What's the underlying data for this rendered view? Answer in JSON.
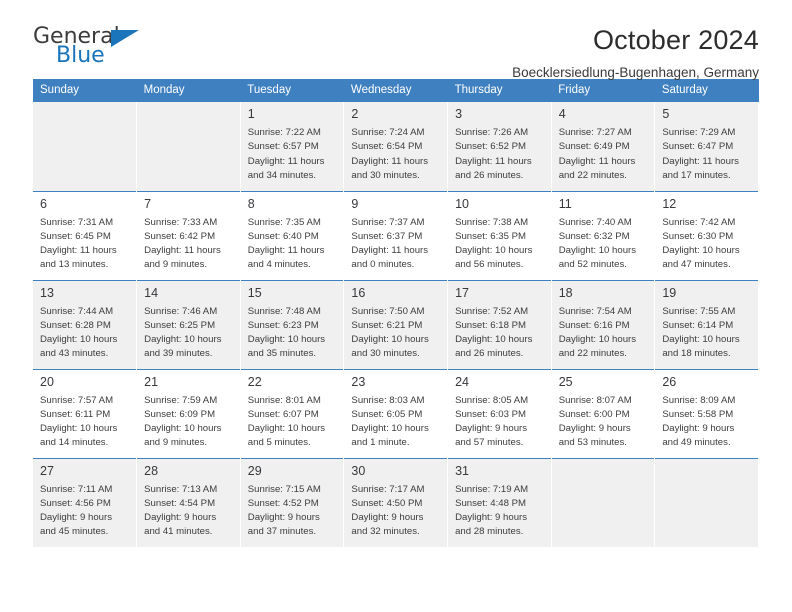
{
  "brand": {
    "name_part1": "General",
    "name_part2": "Blue",
    "triangle_icon": "triangle-icon",
    "accent_color": "#1b75bb"
  },
  "header": {
    "title": "October 2024",
    "subtitle": "Boecklersiedlung-Bugenhagen, Germany"
  },
  "theme": {
    "header_bg": "#3f80c0",
    "header_text": "#ffffff",
    "row_shade": "#f0f0f0",
    "grid_line": "#3f80c0"
  },
  "calendar": {
    "weekday_headers": [
      "Sunday",
      "Monday",
      "Tuesday",
      "Wednesday",
      "Thursday",
      "Friday",
      "Saturday"
    ],
    "labels": {
      "sunrise": "Sunrise:",
      "sunset": "Sunset:",
      "daylight": "Daylight:"
    },
    "weeks": [
      [
        {
          "day": "",
          "sunrise": "",
          "sunset": "",
          "daylight_line1": "",
          "daylight_line2": ""
        },
        {
          "day": "",
          "sunrise": "",
          "sunset": "",
          "daylight_line1": "",
          "daylight_line2": ""
        },
        {
          "day": "1",
          "sunrise": "Sunrise: 7:22 AM",
          "sunset": "Sunset: 6:57 PM",
          "daylight_line1": "Daylight: 11 hours",
          "daylight_line2": "and 34 minutes."
        },
        {
          "day": "2",
          "sunrise": "Sunrise: 7:24 AM",
          "sunset": "Sunset: 6:54 PM",
          "daylight_line1": "Daylight: 11 hours",
          "daylight_line2": "and 30 minutes."
        },
        {
          "day": "3",
          "sunrise": "Sunrise: 7:26 AM",
          "sunset": "Sunset: 6:52 PM",
          "daylight_line1": "Daylight: 11 hours",
          "daylight_line2": "and 26 minutes."
        },
        {
          "day": "4",
          "sunrise": "Sunrise: 7:27 AM",
          "sunset": "Sunset: 6:49 PM",
          "daylight_line1": "Daylight: 11 hours",
          "daylight_line2": "and 22 minutes."
        },
        {
          "day": "5",
          "sunrise": "Sunrise: 7:29 AM",
          "sunset": "Sunset: 6:47 PM",
          "daylight_line1": "Daylight: 11 hours",
          "daylight_line2": "and 17 minutes."
        }
      ],
      [
        {
          "day": "6",
          "sunrise": "Sunrise: 7:31 AM",
          "sunset": "Sunset: 6:45 PM",
          "daylight_line1": "Daylight: 11 hours",
          "daylight_line2": "and 13 minutes."
        },
        {
          "day": "7",
          "sunrise": "Sunrise: 7:33 AM",
          "sunset": "Sunset: 6:42 PM",
          "daylight_line1": "Daylight: 11 hours",
          "daylight_line2": "and 9 minutes."
        },
        {
          "day": "8",
          "sunrise": "Sunrise: 7:35 AM",
          "sunset": "Sunset: 6:40 PM",
          "daylight_line1": "Daylight: 11 hours",
          "daylight_line2": "and 4 minutes."
        },
        {
          "day": "9",
          "sunrise": "Sunrise: 7:37 AM",
          "sunset": "Sunset: 6:37 PM",
          "daylight_line1": "Daylight: 11 hours",
          "daylight_line2": "and 0 minutes."
        },
        {
          "day": "10",
          "sunrise": "Sunrise: 7:38 AM",
          "sunset": "Sunset: 6:35 PM",
          "daylight_line1": "Daylight: 10 hours",
          "daylight_line2": "and 56 minutes."
        },
        {
          "day": "11",
          "sunrise": "Sunrise: 7:40 AM",
          "sunset": "Sunset: 6:32 PM",
          "daylight_line1": "Daylight: 10 hours",
          "daylight_line2": "and 52 minutes."
        },
        {
          "day": "12",
          "sunrise": "Sunrise: 7:42 AM",
          "sunset": "Sunset: 6:30 PM",
          "daylight_line1": "Daylight: 10 hours",
          "daylight_line2": "and 47 minutes."
        }
      ],
      [
        {
          "day": "13",
          "sunrise": "Sunrise: 7:44 AM",
          "sunset": "Sunset: 6:28 PM",
          "daylight_line1": "Daylight: 10 hours",
          "daylight_line2": "and 43 minutes."
        },
        {
          "day": "14",
          "sunrise": "Sunrise: 7:46 AM",
          "sunset": "Sunset: 6:25 PM",
          "daylight_line1": "Daylight: 10 hours",
          "daylight_line2": "and 39 minutes."
        },
        {
          "day": "15",
          "sunrise": "Sunrise: 7:48 AM",
          "sunset": "Sunset: 6:23 PM",
          "daylight_line1": "Daylight: 10 hours",
          "daylight_line2": "and 35 minutes."
        },
        {
          "day": "16",
          "sunrise": "Sunrise: 7:50 AM",
          "sunset": "Sunset: 6:21 PM",
          "daylight_line1": "Daylight: 10 hours",
          "daylight_line2": "and 30 minutes."
        },
        {
          "day": "17",
          "sunrise": "Sunrise: 7:52 AM",
          "sunset": "Sunset: 6:18 PM",
          "daylight_line1": "Daylight: 10 hours",
          "daylight_line2": "and 26 minutes."
        },
        {
          "day": "18",
          "sunrise": "Sunrise: 7:54 AM",
          "sunset": "Sunset: 6:16 PM",
          "daylight_line1": "Daylight: 10 hours",
          "daylight_line2": "and 22 minutes."
        },
        {
          "day": "19",
          "sunrise": "Sunrise: 7:55 AM",
          "sunset": "Sunset: 6:14 PM",
          "daylight_line1": "Daylight: 10 hours",
          "daylight_line2": "and 18 minutes."
        }
      ],
      [
        {
          "day": "20",
          "sunrise": "Sunrise: 7:57 AM",
          "sunset": "Sunset: 6:11 PM",
          "daylight_line1": "Daylight: 10 hours",
          "daylight_line2": "and 14 minutes."
        },
        {
          "day": "21",
          "sunrise": "Sunrise: 7:59 AM",
          "sunset": "Sunset: 6:09 PM",
          "daylight_line1": "Daylight: 10 hours",
          "daylight_line2": "and 9 minutes."
        },
        {
          "day": "22",
          "sunrise": "Sunrise: 8:01 AM",
          "sunset": "Sunset: 6:07 PM",
          "daylight_line1": "Daylight: 10 hours",
          "daylight_line2": "and 5 minutes."
        },
        {
          "day": "23",
          "sunrise": "Sunrise: 8:03 AM",
          "sunset": "Sunset: 6:05 PM",
          "daylight_line1": "Daylight: 10 hours",
          "daylight_line2": "and 1 minute."
        },
        {
          "day": "24",
          "sunrise": "Sunrise: 8:05 AM",
          "sunset": "Sunset: 6:03 PM",
          "daylight_line1": "Daylight: 9 hours",
          "daylight_line2": "and 57 minutes."
        },
        {
          "day": "25",
          "sunrise": "Sunrise: 8:07 AM",
          "sunset": "Sunset: 6:00 PM",
          "daylight_line1": "Daylight: 9 hours",
          "daylight_line2": "and 53 minutes."
        },
        {
          "day": "26",
          "sunrise": "Sunrise: 8:09 AM",
          "sunset": "Sunset: 5:58 PM",
          "daylight_line1": "Daylight: 9 hours",
          "daylight_line2": "and 49 minutes."
        }
      ],
      [
        {
          "day": "27",
          "sunrise": "Sunrise: 7:11 AM",
          "sunset": "Sunset: 4:56 PM",
          "daylight_line1": "Daylight: 9 hours",
          "daylight_line2": "and 45 minutes."
        },
        {
          "day": "28",
          "sunrise": "Sunrise: 7:13 AM",
          "sunset": "Sunset: 4:54 PM",
          "daylight_line1": "Daylight: 9 hours",
          "daylight_line2": "and 41 minutes."
        },
        {
          "day": "29",
          "sunrise": "Sunrise: 7:15 AM",
          "sunset": "Sunset: 4:52 PM",
          "daylight_line1": "Daylight: 9 hours",
          "daylight_line2": "and 37 minutes."
        },
        {
          "day": "30",
          "sunrise": "Sunrise: 7:17 AM",
          "sunset": "Sunset: 4:50 PM",
          "daylight_line1": "Daylight: 9 hours",
          "daylight_line2": "and 32 minutes."
        },
        {
          "day": "31",
          "sunrise": "Sunrise: 7:19 AM",
          "sunset": "Sunset: 4:48 PM",
          "daylight_line1": "Daylight: 9 hours",
          "daylight_line2": "and 28 minutes."
        },
        {
          "day": "",
          "sunrise": "",
          "sunset": "",
          "daylight_line1": "",
          "daylight_line2": ""
        },
        {
          "day": "",
          "sunrise": "",
          "sunset": "",
          "daylight_line1": "",
          "daylight_line2": ""
        }
      ]
    ]
  }
}
